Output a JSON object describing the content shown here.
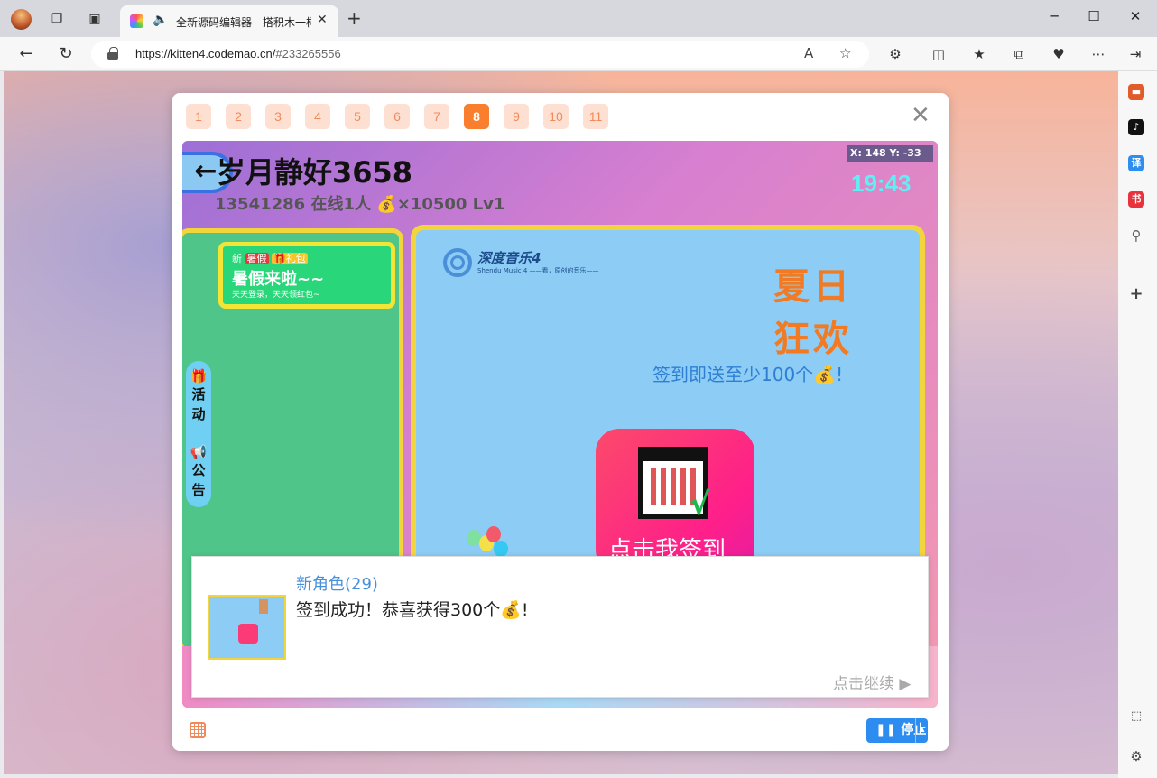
{
  "browser": {
    "tab_title": "全新源码编辑器 - 搭积木一样",
    "url_host": "https://kitten4.codemao.cn/",
    "url_hash": "#233265556",
    "new_tab": "+",
    "close_tab": "✕"
  },
  "modal": {
    "pages": [
      "1",
      "2",
      "3",
      "4",
      "5",
      "6",
      "7",
      "8",
      "9",
      "10",
      "11"
    ],
    "active_page": "8",
    "close": "✕"
  },
  "game": {
    "back": "←",
    "username": "岁月静好3658",
    "user_id": "13541286",
    "online": "在线1人",
    "coins": "💰×10500",
    "level": "Lv1",
    "coords": "X: 148    Y: -33",
    "clock": "19:43",
    "banner": {
      "tag_new": "新",
      "tag_summer": "暑假",
      "tag_gift": "🎁礼包",
      "title": "暑假来啦~~",
      "subtitle": "天天登录，天天领红包~"
    },
    "side_tabs": {
      "activity_icon": "🎁",
      "activity": "活\n动",
      "notice_icon": "📢",
      "notice": "公\n告"
    },
    "logo": {
      "name": "深度音乐4",
      "sub": "Shendu Music 4 ——看，原创的音乐——"
    },
    "summer_title_1": "夏日",
    "summer_title_2": "狂欢",
    "promo": "签到即送至少100个💰!",
    "signin_label": "点击我签到",
    "check": "√"
  },
  "dialog": {
    "speaker": "新角色(29)",
    "message": "签到成功！恭喜获得300个💰!",
    "continue": "点击继续 ▶"
  },
  "controls": {
    "stop": "停止",
    "pause_icon": "❚❚"
  }
}
